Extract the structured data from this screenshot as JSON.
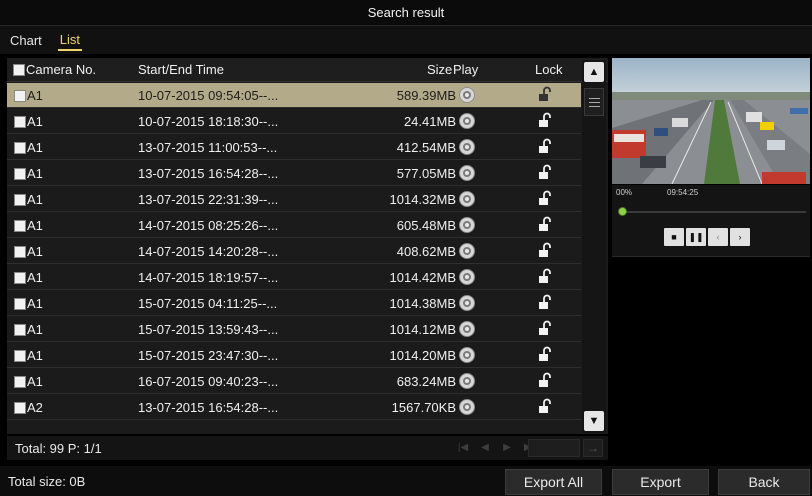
{
  "window": {
    "title": "Search result"
  },
  "tabs": [
    {
      "label": "Chart",
      "active": false
    },
    {
      "label": "List",
      "active": true
    }
  ],
  "table": {
    "headers": {
      "camera": "Camera No.",
      "time": "Start/End Time",
      "size": "Size",
      "play": "Play",
      "lock": "Lock"
    },
    "rows": [
      {
        "camera": "A1",
        "time": "10-07-2015 09:54:05--...",
        "size": "589.39MB",
        "selected": true
      },
      {
        "camera": "A1",
        "time": "10-07-2015 18:18:30--...",
        "size": "24.41MB",
        "selected": false
      },
      {
        "camera": "A1",
        "time": "13-07-2015 11:00:53--...",
        "size": "412.54MB",
        "selected": false
      },
      {
        "camera": "A1",
        "time": "13-07-2015 16:54:28--...",
        "size": "577.05MB",
        "selected": false
      },
      {
        "camera": "A1",
        "time": "13-07-2015 22:31:39--...",
        "size": "1014.32MB",
        "selected": false
      },
      {
        "camera": "A1",
        "time": "14-07-2015 08:25:26--...",
        "size": "605.48MB",
        "selected": false
      },
      {
        "camera": "A1",
        "time": "14-07-2015 14:20:28--...",
        "size": "408.62MB",
        "selected": false
      },
      {
        "camera": "A1",
        "time": "14-07-2015 18:19:57--...",
        "size": "1014.42MB",
        "selected": false
      },
      {
        "camera": "A1",
        "time": "15-07-2015 04:11:25--...",
        "size": "1014.38MB",
        "selected": false
      },
      {
        "camera": "A1",
        "time": "15-07-2015 13:59:43--...",
        "size": "1014.12MB",
        "selected": false
      },
      {
        "camera": "A1",
        "time": "15-07-2015 23:47:30--...",
        "size": "1014.20MB",
        "selected": false
      },
      {
        "camera": "A1",
        "time": "16-07-2015 09:40:23--...",
        "size": "683.24MB",
        "selected": false
      },
      {
        "camera": "A2",
        "time": "13-07-2015 16:54:28--...",
        "size": "1567.70KB",
        "selected": false
      }
    ],
    "play_icon": "play-circle-icon",
    "lock_icon": "unlocked-padlock-icon"
  },
  "footer": {
    "total": "Total: 99  P: 1/1"
  },
  "bottom": {
    "total_size": "Total size: 0B",
    "export_all": "Export All",
    "export": "Export",
    "back": "Back"
  },
  "player": {
    "progress_label": "00%",
    "time": "09:54:25",
    "progress": 0.0
  },
  "colors": {
    "tab_active": "#f4d36a",
    "selected_row": "#b3aa89",
    "progress": "#7fbf3a"
  }
}
